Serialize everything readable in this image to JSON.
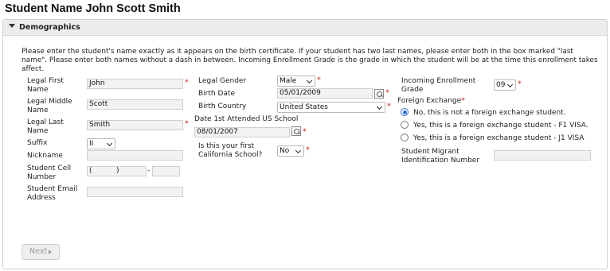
{
  "page": {
    "title": "Student Name John Scott Smith"
  },
  "section": {
    "header": "Demographics"
  },
  "instructions": "Please enter the student's name exactly as it appears on the birth certificate. If your student has two last names, please enter both in the box marked \"last name\". Please enter both names without a dash in between. Incoming Enrollment Grade is the grade in which the student will be at the time this enrollment takes affect.",
  "left": {
    "first_name_label": "Legal First Name",
    "first_name_value": "John",
    "middle_name_label": "Legal Middle Name",
    "middle_name_value": "Scott",
    "last_name_label": "Legal Last Name",
    "last_name_value": "Smith",
    "suffix_label": "Suffix",
    "suffix_value": "II",
    "nickname_label": "Nickname",
    "nickname_value": "",
    "cell_label": "Student Cell Number",
    "cell_area_open": "(",
    "cell_area_close": ")",
    "cell_dash": "-",
    "email_label": "Student Email Address",
    "email_value": ""
  },
  "middle": {
    "gender_label": "Legal Gender",
    "gender_value": "Male",
    "birth_date_label": "Birth Date",
    "birth_date_value": "05/01/2009",
    "birth_country_label": "Birth Country",
    "birth_country_value": "United States",
    "date_attended_label": "Date 1st Attended US School",
    "date_attended_value": "08/01/2007",
    "first_ca_school_label": "Is this your first California School?",
    "first_ca_school_value": "No"
  },
  "right": {
    "grade_label": "Incoming Enrollment Grade",
    "grade_value": "09",
    "foreign_exchange_label": "Foreign Exchange",
    "foreign_exchange_options": [
      "No, this is not a foreign exchange student.",
      "Yes, this is a foreign exchange student - F1 VISA.",
      "Yes, this is a foreign exchange student - J1 VISA"
    ],
    "selected_option_index": 0,
    "migrant_label": "Student Migrant Identification Number",
    "migrant_value": ""
  },
  "required_mark": "*",
  "next_button": "Next"
}
